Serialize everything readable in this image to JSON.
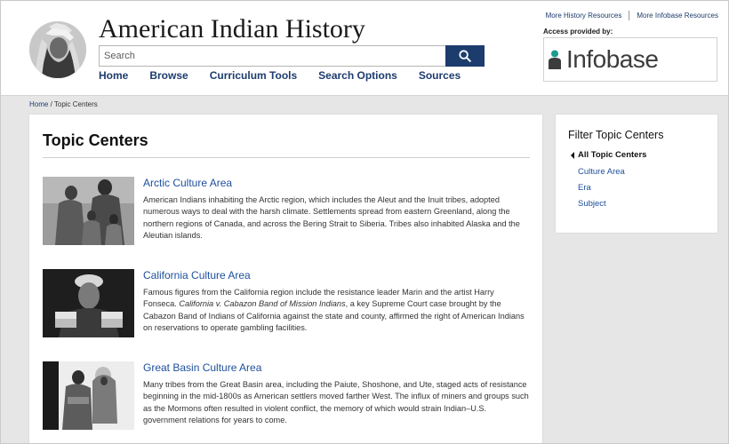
{
  "header": {
    "site_title": "American Indian History",
    "search_placeholder": "Search",
    "nav": [
      "Home",
      "Browse",
      "Curriculum Tools",
      "Search Options",
      "Sources"
    ],
    "top_links": [
      "More History Resources",
      "More Infobase Resources"
    ],
    "access_label": "Access provided by:",
    "partner_name": "Infobase"
  },
  "breadcrumb": {
    "home": "Home",
    "current": "Topic Centers"
  },
  "main": {
    "title": "Topic Centers",
    "topics": [
      {
        "title": "Arctic Culture Area",
        "description": "American Indians inhabiting the Arctic region, which includes the Aleut and the Inuit tribes, adopted numerous ways to deal with the harsh climate. Settlements spread from eastern Greenland, along the northern regions of Canada, and across the Bering Strait to Siberia. Tribes also inhabited Alaska and the Aleutian islands."
      },
      {
        "title": "California Culture Area",
        "description_before": "Famous figures from the California region include the resistance leader Marin and the artist Harry Fonseca. ",
        "description_italic": "California v. Cabazon Band of Mission Indians",
        "description_after": ", a key Supreme Court case brought by the Cabazon Band of Indians of California against the state and county, affirmed the right of American Indians on reservations to operate gambling facilities."
      },
      {
        "title": "Great Basin Culture Area",
        "description": "Many tribes from the Great Basin area, including the Paiute, Shoshone, and Ute, staged acts of resistance beginning in the mid-1800s as American settlers moved farther West. The influx of miners and groups such as the Mormons often resulted in violent conflict, the memory of which would strain Indian–U.S. government relations for years to come."
      }
    ]
  },
  "filter": {
    "title": "Filter Topic Centers",
    "all_label": "All Topic Centers",
    "options": [
      "Culture Area",
      "Era",
      "Subject"
    ]
  },
  "colors": {
    "brand_navy": "#1d3c6e",
    "link_blue": "#1d4f9c",
    "page_background": "#e6e6e6"
  },
  "icons": {
    "search_button": "search-icon",
    "site_logo": "site-logo-portrait",
    "partner_logo": "infobase-logo-icon",
    "filter_back": "caret-left-icon"
  }
}
